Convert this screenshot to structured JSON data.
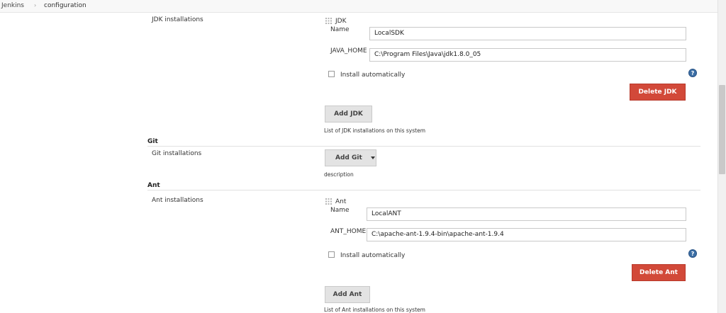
{
  "breadcrumb": {
    "root": "Jenkins",
    "separator": "›",
    "current": "configuration"
  },
  "jdk": {
    "section_label": "JDK installations",
    "block_title": "JDK",
    "name_label": "Name",
    "name_value": "LocalSDK",
    "home_label": "JAVA_HOME",
    "home_value": "C:\\Program Files\\Java\\jdk1.8.0_05",
    "install_auto_label": "Install automatically",
    "install_auto_checked": false,
    "delete_button": "Delete JDK",
    "add_button": "Add JDK",
    "list_desc": "List of JDK installations on this system"
  },
  "git": {
    "section_title": "Git",
    "section_label": "Git installations",
    "add_button": "Add Git",
    "desc": "description"
  },
  "ant": {
    "section_title": "Ant",
    "section_label": "Ant installations",
    "block_title": "Ant",
    "name_label": "Name",
    "name_value": "LocalANT",
    "home_label": "ANT_HOME",
    "home_value": "C:\\apache-ant-1.9.4-bin\\apache-ant-1.9.4",
    "install_auto_label": "Install automatically",
    "install_auto_checked": false,
    "delete_button": "Delete Ant",
    "add_button": "Add Ant",
    "list_desc": "List of Ant installations on this system"
  },
  "help_icon_glyph": "?",
  "colors": {
    "delete_button": "#d24939",
    "help_icon": "#3b6ea5",
    "grey_button": "#e3e3e3"
  }
}
